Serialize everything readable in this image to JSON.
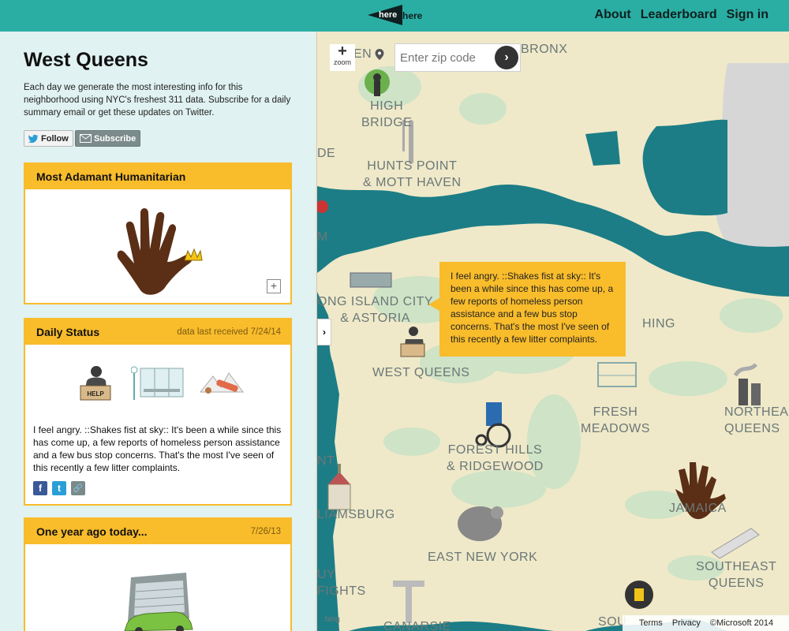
{
  "brand": {
    "text_white": "here",
    "text_dark": "here"
  },
  "nav": {
    "about": "About",
    "leaderboard": "Leaderboard",
    "signin": "Sign in"
  },
  "sidebar": {
    "title": "West Queens",
    "description": "Each day we generate the most interesting info for this neighborhood using NYC's freshest 311 data. Subscribe for a daily summary email or get these updates on Twitter.",
    "follow_label": "Follow",
    "subscribe_label": "Subscribe"
  },
  "cards": {
    "award": {
      "title": "Most Adamant Humanitarian"
    },
    "status": {
      "title": "Daily Status",
      "date": "data last received 7/24/14",
      "help_label": "HELP",
      "text": "I feel angry. ::Shakes fist at sky:: It's been a while since this has come up, a few reports of homeless person assistance and a few bus stop concerns. That's the most I've seen of this recently a few litter complaints.",
      "social": {
        "facebook": "f",
        "twitter": "t",
        "link": "🔗"
      }
    },
    "ago": {
      "title": "One year ago today...",
      "date": "7/26/13"
    }
  },
  "map": {
    "zoom_label": "zoom",
    "zip_placeholder": "Enter zip code",
    "tooltip": "I feel angry. ::Shakes fist at sky:: It's been a while since this has come up, a few reports of homeless person assistance and a few bus stop concerns. That's the most I've seen of this recently a few litter complaints.",
    "tooltip_help": "HELP",
    "bing": "bing",
    "labels": {
      "high_bridge": "HIGH\nBRIDGE",
      "hunts_point": "HUNTS POINT\n& MOTT HAVEN",
      "bronx": "BRONX",
      "lic": "ONG ISLAND CITY\n& ASTORIA",
      "west_queens": "WEST QUEENS",
      "hing": "HING",
      "fresh_meadows": "FRESH\nMEADOWS",
      "northeast_queens": "NORTHEAS\nQUEENS",
      "forest_hills": "FOREST HILLS\n& RIDGEWOOD",
      "jamaica": "JAMAICA",
      "williamsburg": "LIAMSBURG",
      "east_new_york": "EAST NEW YORK",
      "southeast_queens": "SOUTHEAST\nQUEENS",
      "uy_fights": "UY\nFIGHTS",
      "canarsie": "CANARSIE",
      "sou": "SOU",
      "en": "EN",
      "de": "DE",
      "m": "M",
      "nt": "NT"
    },
    "footer": {
      "terms": "Terms",
      "privacy": "Privacy",
      "copyright": "©Microsoft 2014"
    }
  },
  "colors": {
    "teal": "#2aaea4",
    "water": "#1c7d86",
    "land": "#efe9c9",
    "park": "#cfe3c6",
    "accent": "#f9bc2b",
    "sidebar_bg": "#e0f2f1"
  },
  "icons": [
    "megaphone-icon",
    "twitter-icon",
    "mail-icon",
    "handprint-icon",
    "homeless-help-icon",
    "bus-stop-icon",
    "litter-icon",
    "facebook-icon",
    "link-icon",
    "pin-icon",
    "arrow-right-icon",
    "chevron-right-icon",
    "wheelchair-icon",
    "garage-car-icon",
    "fork-knife-icon",
    "park-person-icon"
  ]
}
